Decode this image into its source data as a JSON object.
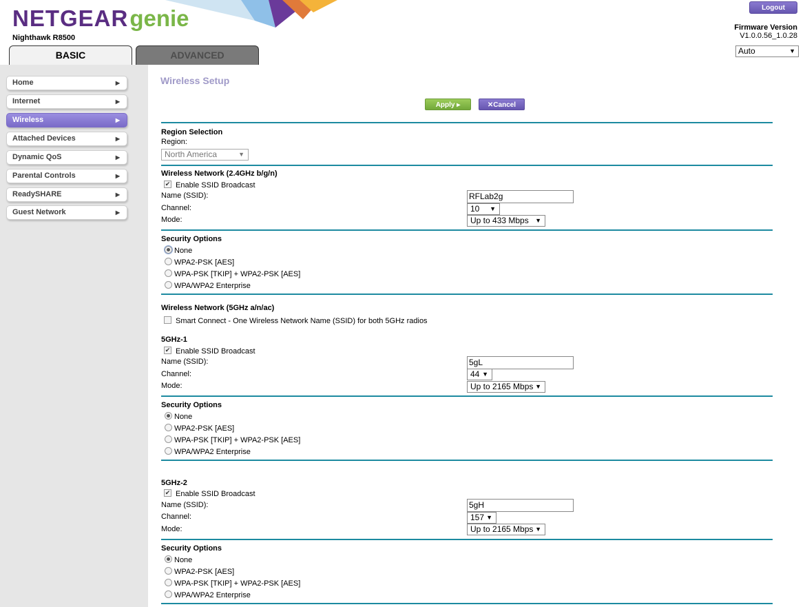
{
  "header": {
    "brand": "NETGEAR",
    "product": "genie",
    "model": "Nighthawk R8500",
    "logout_label": "Logout",
    "firmware_title": "Firmware Version",
    "firmware_value": "V1.0.0.56_1.0.28",
    "language_value": "Auto",
    "tabs": [
      {
        "label": "BASIC",
        "active": true
      },
      {
        "label": "ADVANCED",
        "active": false
      }
    ]
  },
  "sidebar": {
    "items": [
      {
        "label": "Home"
      },
      {
        "label": "Internet"
      },
      {
        "label": "Wireless",
        "active": true
      },
      {
        "label": "Attached Devices"
      },
      {
        "label": "Dynamic QoS"
      },
      {
        "label": "Parental Controls"
      },
      {
        "label": "ReadySHARE"
      },
      {
        "label": "Guest Network"
      }
    ]
  },
  "main": {
    "title": "Wireless Setup",
    "apply_label": "Apply ▸",
    "cancel_label": "Cancel",
    "region": {
      "heading": "Region Selection",
      "label": "Region:",
      "value": "North America"
    },
    "labels": {
      "enable_ssid": "Enable SSID Broadcast",
      "name": "Name (SSID):",
      "channel": "Channel:",
      "mode": "Mode:",
      "security": "Security Options",
      "opt_none": "None",
      "opt_wpa2": "WPA2-PSK [AES]",
      "opt_mixed": "WPA-PSK [TKIP] + WPA2-PSK [AES]",
      "opt_ent": "WPA/WPA2 Enterprise"
    },
    "net24": {
      "heading": "Wireless Network (2.4GHz b/g/n)",
      "ssid": "RFLab2g",
      "channel": "10",
      "mode": "Up to 433 Mbps",
      "security_selected": "None"
    },
    "net5": {
      "heading": "Wireless Network (5GHz a/n/ac)",
      "smart_connect": "Smart Connect - One Wireless Network Name (SSID) for both 5GHz radios"
    },
    "g1": {
      "heading": "5GHz-1",
      "ssid": "5gL",
      "channel": "44",
      "mode": "Up to 2165 Mbps",
      "security_selected": "None"
    },
    "g2": {
      "heading": "5GHz-2",
      "ssid": "5gH",
      "channel": "157",
      "mode": "Up to 2165 Mbps",
      "security_selected": "None"
    }
  }
}
